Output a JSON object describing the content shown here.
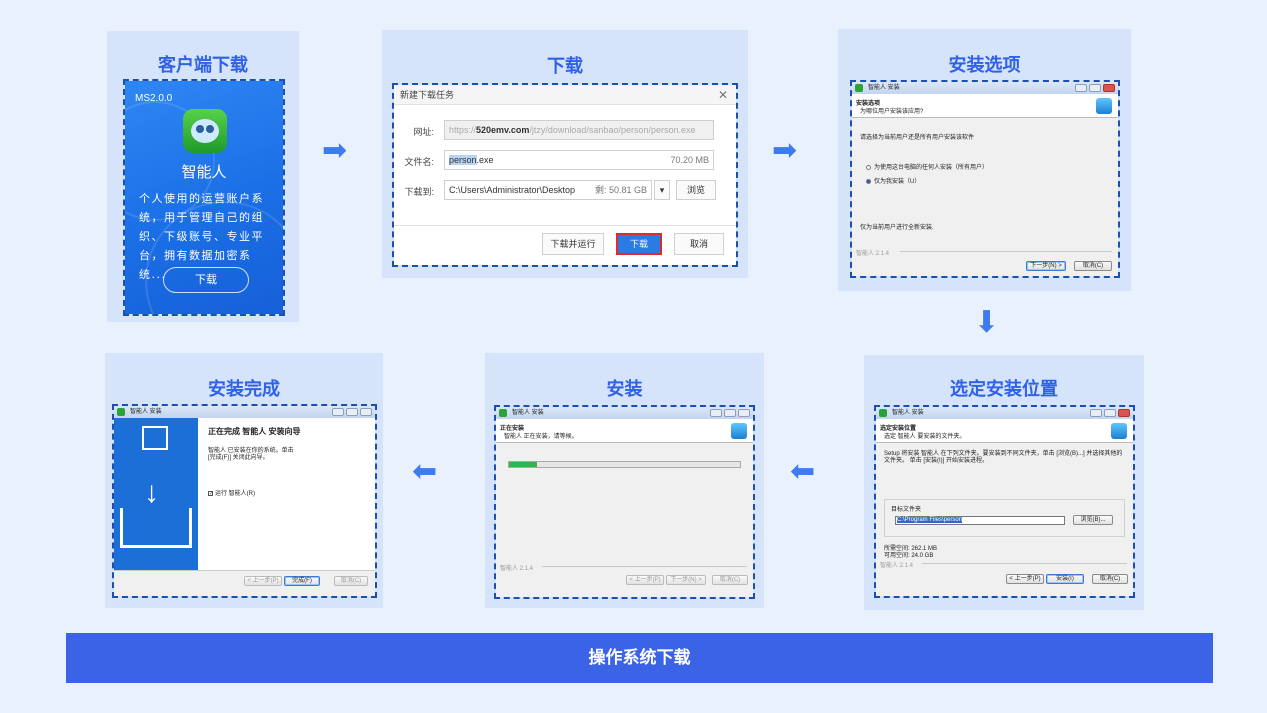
{
  "cards": {
    "client_download": {
      "title": "客户端下载",
      "version": "MS2.0.0",
      "app_name": "智能人",
      "description": "个人使用的运营账户系统，用于管理自己的组织、下级账号、专业平台，拥有数据加密系统...",
      "download_button": "下载"
    },
    "download": {
      "title": "下载",
      "dialog_title": "新建下载任务",
      "url_label": "网址:",
      "url_prefix": "https://",
      "url_domain": "520emv.com",
      "url_path": "/jtzy/download/sanbao/person/person.exe",
      "filename_label": "文件名:",
      "filename_sel": "person",
      "filename_rest": ".exe",
      "file_size": "70.20 MB",
      "saveto_label": "下载到:",
      "saveto_path": "C:\\Users\\Administrator\\Desktop",
      "free_space": "剩: 50.81 GB",
      "browse_button": "浏览",
      "download_and_run": "下载并运行",
      "download_button": "下载",
      "cancel_button": "取消"
    },
    "install_options": {
      "title": "安装选项",
      "win_title": "智能人 安装",
      "header_title": "安装选项",
      "header_subtitle": "为哪位用户安装该应用?",
      "prompt": "请选择为当前用户还是所有用户安装该软件",
      "option_all": "为使用这台电脑的任何人安装（所有用户）",
      "option_me": "仅为我安装（U）",
      "note": "仅为当前用户进行全新安装.",
      "brand": "智能人 2.1.4",
      "next_button": "下一步(N) >",
      "cancel_button": "取消(C)"
    },
    "choose_location": {
      "title": "选定安装位置",
      "win_title": "智能人 安装",
      "header_title": "选定安装位置",
      "header_subtitle": "选定 智能人 要安装的文件夹。",
      "instructions": "Setup 将安装 智能人 在下列文件夹。要安装到不同文件夹，单击 [浏览(B)...] 并选择其他的文件夹。 单击 [安装(I)] 开始安装进程。",
      "folder_group": "目标文件夹",
      "folder_path": "C:\\Program Files\\person",
      "browse_button": "浏览(B)...",
      "space_required": "所需空间: 262.1 MB",
      "space_available": "可用空间: 24.0 GB",
      "brand": "智能人 2.1.4",
      "back_button": "< 上一步(P)",
      "install_button": "安装(I)",
      "cancel_button": "取消(C)"
    },
    "installing": {
      "title": "安装",
      "win_title": "智能人 安装",
      "header_title": "正在安装",
      "header_subtitle": "智能人 正在安装，请等候。",
      "progress": 0.12,
      "brand": "智能人 2.1.4",
      "back_button": "< 上一步(P)",
      "next_button": "下一步(N) >",
      "cancel_button": "取消(C)"
    },
    "complete": {
      "title": "安装完成",
      "win_title": "智能人 安装",
      "heading": "正在完成 智能人 安装向导",
      "body": "智能人 已安装在你的系统。单击 [完成(F)] 关闭此向导。",
      "run_checkbox": "运行 智能人(R)",
      "back_button": "< 上一步(P)",
      "finish_button": "完成(F)",
      "cancel_button": "取消(C)"
    }
  },
  "footer": "操作系统下载",
  "colors": {
    "background": "#e9f1fd",
    "card": "#d6e4fb",
    "title": "#2f62e6",
    "arrow": "#3d7bf0",
    "footer": "#3b63e6"
  }
}
